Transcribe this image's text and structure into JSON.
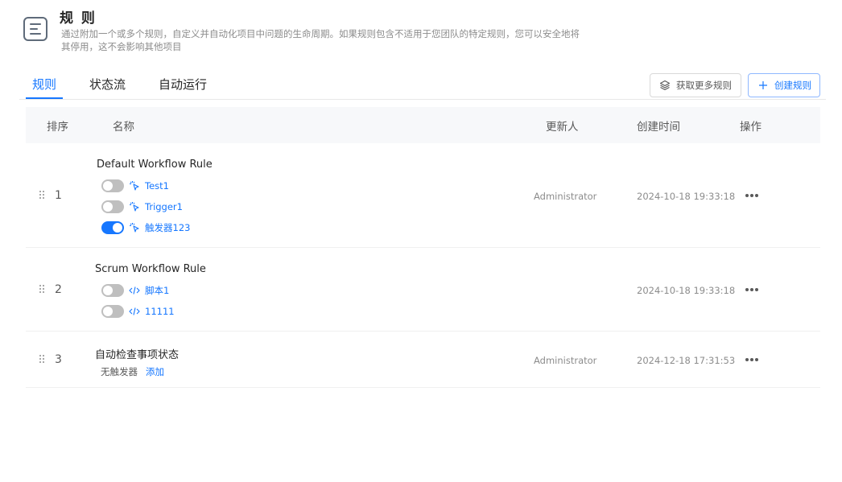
{
  "header": {
    "title": "规 则",
    "description": "通过附加一个或多个规则，自定义并自动化项目中问题的生命周期。如果规则包含不适用于您团队的特定规则，您可以安全地将其停用，这不会影响其他项目",
    "icon": "list-document-icon"
  },
  "tabs": [
    {
      "label": "规则",
      "active": true
    },
    {
      "label": "状态流",
      "active": false
    },
    {
      "label": "自动运行",
      "active": false
    }
  ],
  "toolbar": {
    "more_rules_label": "获取更多规则",
    "create_rule_label": "创建规则"
  },
  "table": {
    "columns": {
      "order": "排序",
      "name": "名称",
      "updater": "更新人",
      "created": "创建时间",
      "actions": "操作"
    },
    "rows": [
      {
        "order": "1",
        "name": "Default Workflow Rule",
        "updater": "Administrator",
        "created": "2024-10-18 19:33:18",
        "triggers": [
          {
            "label": "Test1",
            "enabled": false,
            "icon": "click-spark-icon"
          },
          {
            "label": "Trigger1",
            "enabled": false,
            "icon": "click-spark-icon"
          },
          {
            "label": "触发器123",
            "enabled": true,
            "icon": "click-spark-icon"
          }
        ]
      },
      {
        "order": "2",
        "name": "Scrum Workflow Rule",
        "updater": "",
        "created": "2024-10-18 19:33:18",
        "triggers": [
          {
            "label": "脚本1",
            "enabled": false,
            "icon": "code-icon"
          },
          {
            "label": "11111",
            "enabled": false,
            "icon": "code-icon"
          }
        ]
      },
      {
        "order": "3",
        "name": "自动检查事项状态",
        "updater": "Administrator",
        "created": "2024-12-18 17:31:53",
        "no_trigger_label": "无触发器",
        "add_label": "添加"
      }
    ]
  },
  "colors": {
    "accent": "#1677ff",
    "toggle_off": "#bfbfbf",
    "header_bg": "#f7f8fa"
  }
}
